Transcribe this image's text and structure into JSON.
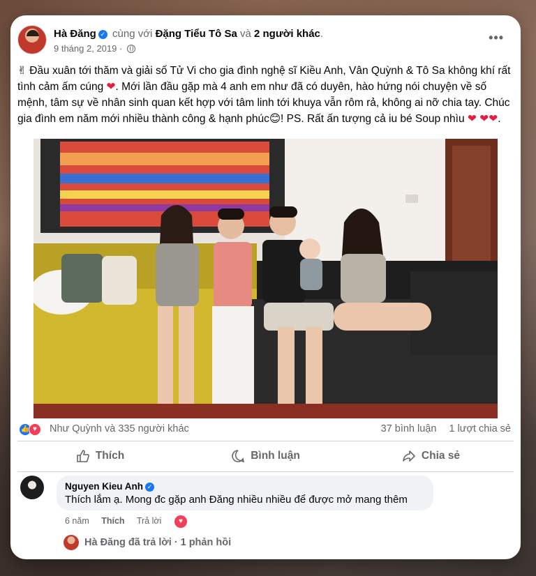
{
  "post": {
    "author": "Hà Đăng",
    "with_text": "cùng với",
    "tagged": "Đặng Tiểu Tô Sa",
    "and_text": "và",
    "others": "2 người khác",
    "date": "9 tháng 2, 2019 ·",
    "more_icon": "•••",
    "text_part1": "✌ Đầu xuân tới thăm và giải số Tử Vi cho gia đình nghệ sĩ Kiều Anh, Vân Quỳnh & Tô Sa  không khí rất tình cảm ấm cúng ",
    "text_part2": ". Mới lần đầu gặp mà 4 anh em như đã có duyên, hào hứng nói chuyện về số mệnh, tâm sự về nhân sinh quan kết hợp với tâm linh tới khuya vẫn rôm rả, không ai nỡ chia tay. Chúc gia đình em năm mới nhiều thành công & hạnh phúc",
    "text_part3": "! PS. Rất ấn tượng cả iu bé Soup nhìu ",
    "heart": "❤",
    "smile": "😊",
    "hearts2": "❤❤",
    "end_dot": "."
  },
  "reactions": {
    "text": "Như Quỳnh và 335 người khác",
    "comments": "37 bình luận",
    "shares": "1 lượt chia sẻ"
  },
  "actions": {
    "like": "Thích",
    "comment": "Bình luận",
    "share": "Chia sẻ"
  },
  "comment": {
    "author": "Nguyen Kieu Anh",
    "text": "Thích lắm ạ. Mong đc gặp anh Đăng nhiều nhiều để được mở mang thêm",
    "time": "6 năm",
    "like": "Thích",
    "reply": "Trả lời",
    "reply_summary": "Hà Đăng đã trả lời · 1 phản hồi"
  },
  "colors": {
    "accent": "#1877f2",
    "love": "#f33e58",
    "text_secondary": "#65676b"
  }
}
